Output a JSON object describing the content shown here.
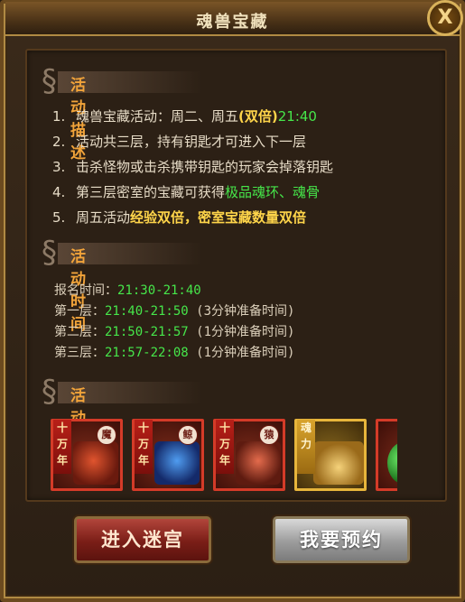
{
  "window": {
    "title": "魂兽宝藏",
    "close_label": "X"
  },
  "sections": {
    "description": {
      "label": "活动描述",
      "items": [
        {
          "num": "1.",
          "parts": [
            {
              "text": "魂兽宝藏活动：周二、周五"
            },
            {
              "text": "(双倍)"
            },
            {
              "text": "21:40"
            }
          ]
        },
        {
          "num": "2.",
          "parts": [
            {
              "text": "活动共三层，持有钥匙才可进入下一层"
            }
          ]
        },
        {
          "num": "3.",
          "parts": [
            {
              "text": "击杀怪物或击杀携带钥匙的玩家会掉落钥匙"
            }
          ]
        },
        {
          "num": "4.",
          "parts": [
            {
              "text": "第三层密室的宝藏可获得"
            },
            {
              "text": "极品魂环、魂骨"
            }
          ]
        },
        {
          "num": "5.",
          "parts": [
            {
              "text": "周五活动"
            },
            {
              "text": "经验双倍，密室宝藏数量双倍"
            }
          ]
        }
      ]
    },
    "time": {
      "label": "活动时间",
      "rows": [
        {
          "name": "报名时间：",
          "time": "21:30-21:40",
          "note": ""
        },
        {
          "name": "第一层：",
          "time": "21:40-21:50",
          "note": "(3分钟准备时间)"
        },
        {
          "name": "第二层：",
          "time": "21:50-21:57",
          "note": "(1分钟准备时间)"
        },
        {
          "name": "第三层：",
          "time": "21:57-22:08",
          "note": "(1分钟准备时间)"
        }
      ]
    },
    "rewards": {
      "label": "活动奖励",
      "items": [
        {
          "ribbon": "十万年",
          "tag": "魔",
          "icon": "demon-dragon-icon"
        },
        {
          "ribbon": "十万年",
          "tag": "鲸",
          "icon": "blue-whale-beast-icon"
        },
        {
          "ribbon": "十万年",
          "tag": "猿",
          "icon": "red-ape-beast-icon"
        },
        {
          "ribbon": "魂力",
          "tag": "",
          "icon": "gold-money-bag-icon"
        },
        {
          "ribbon": "",
          "tag": "",
          "icon": "green-orb-icon"
        }
      ]
    }
  },
  "buttons": {
    "enter": "进入迷宫",
    "reserve": "我要预约"
  },
  "colors": {
    "accent_orange": "#f2a43a",
    "highlight_yellow": "#ffd54a",
    "highlight_green": "#46e64a"
  }
}
